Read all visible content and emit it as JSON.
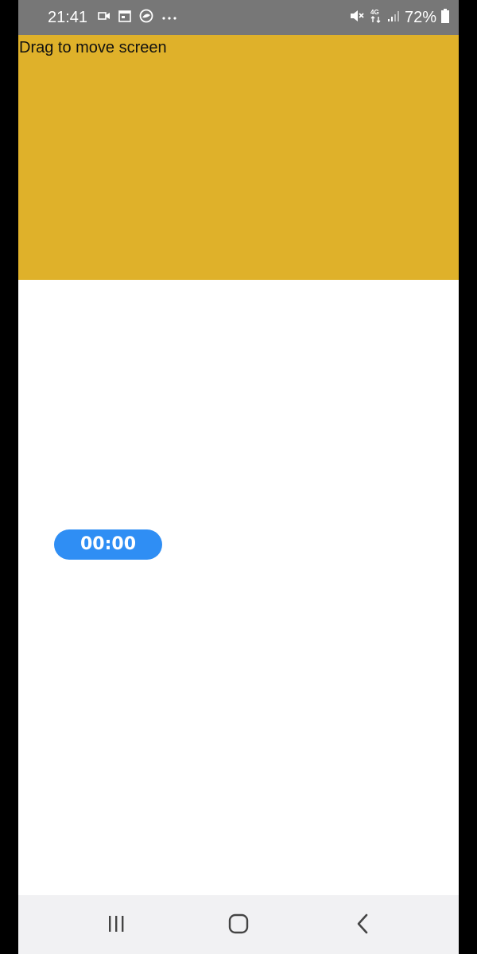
{
  "status_bar": {
    "time": "21:41",
    "battery": "72%",
    "left_icons": [
      "video-call-icon",
      "calendar-icon",
      "app-notification-icon",
      "more-notifications-icon"
    ],
    "right_icons": [
      "mute-icon",
      "4g-data-icon",
      "signal-icon",
      "battery-icon"
    ]
  },
  "drag_panel": {
    "label": "Drag to move screen",
    "color": "#dfb12a"
  },
  "timer": {
    "value": "00:00",
    "color": "#2f8ef4"
  },
  "nav_bar": {
    "buttons": [
      "recent-apps-icon",
      "home-icon",
      "back-icon"
    ]
  }
}
